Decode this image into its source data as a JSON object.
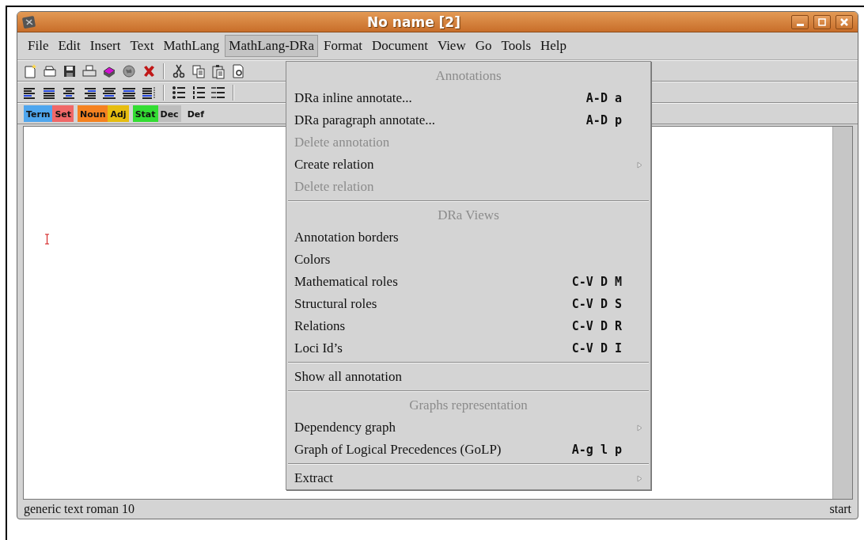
{
  "window": {
    "title": "No name [2]"
  },
  "menubar": [
    {
      "label": "File",
      "selected": false
    },
    {
      "label": "Edit",
      "selected": false
    },
    {
      "label": "Insert",
      "selected": false
    },
    {
      "label": "Text",
      "selected": false
    },
    {
      "label": "MathLang",
      "selected": false
    },
    {
      "label": "MathLang-DRa",
      "selected": true
    },
    {
      "label": "Format",
      "selected": false
    },
    {
      "label": "Document",
      "selected": false
    },
    {
      "label": "View",
      "selected": false
    },
    {
      "label": "Go",
      "selected": false
    },
    {
      "label": "Tools",
      "selected": false
    },
    {
      "label": "Help",
      "selected": false
    }
  ],
  "tags": [
    {
      "label": "Term",
      "color": "#4fa6ee"
    },
    {
      "label": "Set",
      "color": "#f06868"
    },
    {
      "label": "Noun",
      "color": "#f58220"
    },
    {
      "label": "Adj",
      "color": "#e6bd10"
    },
    {
      "label": "Stat",
      "color": "#33dd33"
    },
    {
      "label": "Dec",
      "color": "#bdbdbd"
    },
    {
      "label": "Def",
      "color": "#d4d4d4"
    }
  ],
  "menu": {
    "items": [
      {
        "kind": "header",
        "label": "Annotations"
      },
      {
        "kind": "item",
        "label": "DRa inline annotate...",
        "shortcut": "A-D a",
        "disabled": false,
        "submenu": false
      },
      {
        "kind": "item",
        "label": "DRa paragraph annotate...",
        "shortcut": "A-D p",
        "disabled": false,
        "submenu": false
      },
      {
        "kind": "item",
        "label": "Delete annotation",
        "disabled": true,
        "submenu": false
      },
      {
        "kind": "item",
        "label": "Create relation",
        "disabled": false,
        "submenu": true
      },
      {
        "kind": "item",
        "label": "Delete relation",
        "disabled": true,
        "submenu": false
      },
      {
        "kind": "separator"
      },
      {
        "kind": "header",
        "label": "DRa Views"
      },
      {
        "kind": "item",
        "label": "Annotation borders",
        "disabled": false,
        "submenu": false
      },
      {
        "kind": "item",
        "label": "Colors",
        "disabled": false,
        "submenu": false
      },
      {
        "kind": "item",
        "label": "Mathematical roles",
        "shortcut": "C-V D M",
        "disabled": false,
        "submenu": false
      },
      {
        "kind": "item",
        "label": "Structural roles",
        "shortcut": "C-V D S",
        "disabled": false,
        "submenu": false
      },
      {
        "kind": "item",
        "label": "Relations",
        "shortcut": "C-V D R",
        "disabled": false,
        "submenu": false
      },
      {
        "kind": "item",
        "label": "Loci Id’s",
        "shortcut": "C-V D I",
        "disabled": false,
        "submenu": false
      },
      {
        "kind": "separator"
      },
      {
        "kind": "item",
        "label": "Show all annotation",
        "disabled": false,
        "submenu": false
      },
      {
        "kind": "separator"
      },
      {
        "kind": "header",
        "label": "Graphs representation"
      },
      {
        "kind": "item",
        "label": "Dependency graph",
        "disabled": false,
        "submenu": true
      },
      {
        "kind": "item",
        "label": "Graph of Logical Precedences (GoLP)",
        "shortcut": "A-g l p",
        "disabled": false,
        "submenu": false
      },
      {
        "kind": "separator"
      },
      {
        "kind": "item",
        "label": "Extract",
        "disabled": false,
        "submenu": true
      }
    ]
  },
  "status_bar": {
    "left": "generic text roman 10",
    "right": "start"
  }
}
